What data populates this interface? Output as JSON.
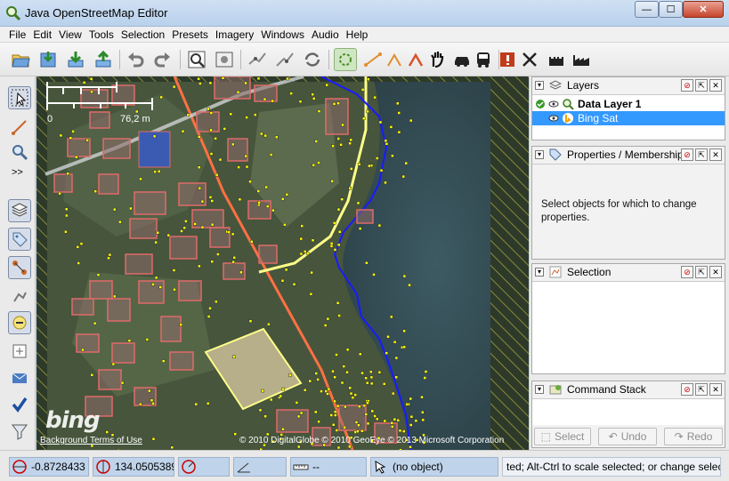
{
  "window": {
    "title": "Java OpenStreetMap Editor",
    "controls": {
      "minimize": "—",
      "maximize": "☐",
      "close": "✕"
    }
  },
  "menu": [
    "File",
    "Edit",
    "View",
    "Tools",
    "Selection",
    "Presets",
    "Imagery",
    "Windows",
    "Audio",
    "Help"
  ],
  "toolbar": {
    "icons": [
      "open-icon",
      "save-icon",
      "download-icon",
      "upload-icon",
      "undo-icon",
      "redo-icon",
      "zoom-to-data-icon",
      "preferences-icon",
      "split-way-icon",
      "combine-way-icon",
      "reverse-way-icon",
      "align-circle-icon",
      "align-line-icon",
      "orthogonalize-icon",
      "pan-icon",
      "car-icon",
      "bus-icon",
      "warning-icon",
      "tools-icon",
      "castle-icon",
      "factory-icon"
    ]
  },
  "left_tools": {
    "expand_label": ">>",
    "icons": [
      "select-mode-icon",
      "draw-mode-icon",
      "zoom-mode-icon",
      "layers-dialog-icon",
      "tag-dialog-icon",
      "relation-dialog-icon",
      "selection-list-icon",
      "conflict-dialog-icon",
      "filter-icon",
      "message-icon",
      "validate-icon",
      "funnel-icon"
    ]
  },
  "map": {
    "scale": {
      "zero": "0",
      "length": "76,2 m"
    },
    "attribution": {
      "logo": "bing",
      "terms": "Background Terms of Use",
      "credits": "© 2010 DigitalGlobe © 2010 GeoEye © 2013 Microsoft Corporation"
    }
  },
  "panels": {
    "layers": {
      "title": "Layers",
      "items": [
        {
          "name": "Data Layer 1",
          "active": true,
          "visible": true,
          "selected": false
        },
        {
          "name": "Bing Sat",
          "active": false,
          "visible": true,
          "selected": true
        }
      ]
    },
    "properties": {
      "title": "Properties / Memberships",
      "empty_text": "Select objects for which to change properties."
    },
    "selection": {
      "title": "Selection"
    },
    "command_stack": {
      "title": "Command Stack",
      "buttons": {
        "select": "Select",
        "undo": "Undo",
        "redo": "Redo"
      }
    }
  },
  "status": {
    "lat": "-0.8728433",
    "lon": "134.0505389",
    "heading": "",
    "angle": "",
    "length": "--",
    "object": "(no object)",
    "help": "ted; Alt-Ctrl to scale selected; or change selection"
  },
  "colors": {
    "selection_highlight": "#3399ff",
    "building_outline": "#e06a6a",
    "node": "#ffff00",
    "main_road": "#ff7043",
    "secondary_road": "#ffff88",
    "coastline": "#1a1aff"
  }
}
